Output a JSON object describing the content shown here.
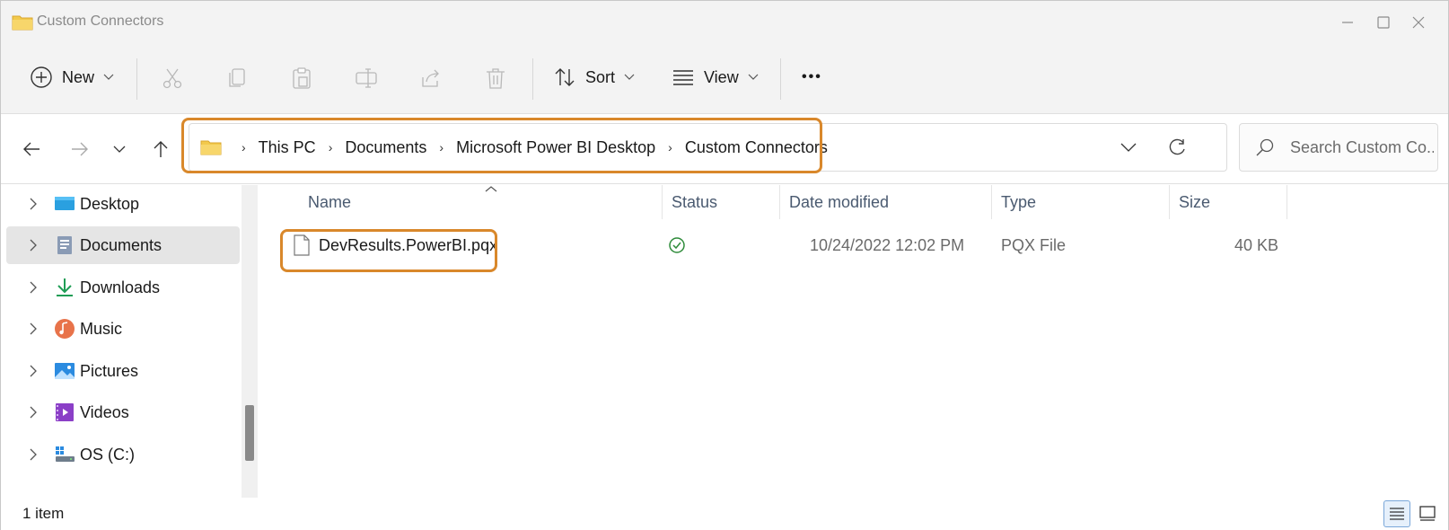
{
  "window": {
    "title": "Custom Connectors"
  },
  "toolbar": {
    "new_label": "New",
    "sort_label": "Sort",
    "view_label": "View",
    "more_label": "•••"
  },
  "address": {
    "crumbs": [
      "This PC",
      "Documents",
      "Microsoft Power BI Desktop",
      "Custom Connectors"
    ],
    "search_placeholder": "Search Custom Co..."
  },
  "sidebar": {
    "items": [
      {
        "label": "Desktop",
        "icon": "desktop-icon"
      },
      {
        "label": "Documents",
        "icon": "documents-icon",
        "selected": true
      },
      {
        "label": "Downloads",
        "icon": "downloads-icon"
      },
      {
        "label": "Music",
        "icon": "music-icon"
      },
      {
        "label": "Pictures",
        "icon": "pictures-icon"
      },
      {
        "label": "Videos",
        "icon": "videos-icon"
      },
      {
        "label": "OS (C:)",
        "icon": "drive-icon"
      }
    ]
  },
  "columns": {
    "name": "Name",
    "status": "Status",
    "date": "Date modified",
    "type": "Type",
    "size": "Size"
  },
  "files": [
    {
      "name": "DevResults.PowerBI.pqx",
      "status": "available",
      "date": "10/24/2022 12:02 PM",
      "type": "PQX File",
      "size": "40 KB"
    }
  ],
  "statusbar": {
    "count": "1 item"
  },
  "colors": {
    "highlight": "#d9882b",
    "status_ok": "#2e8b3a",
    "folder": "#f2c94c"
  }
}
